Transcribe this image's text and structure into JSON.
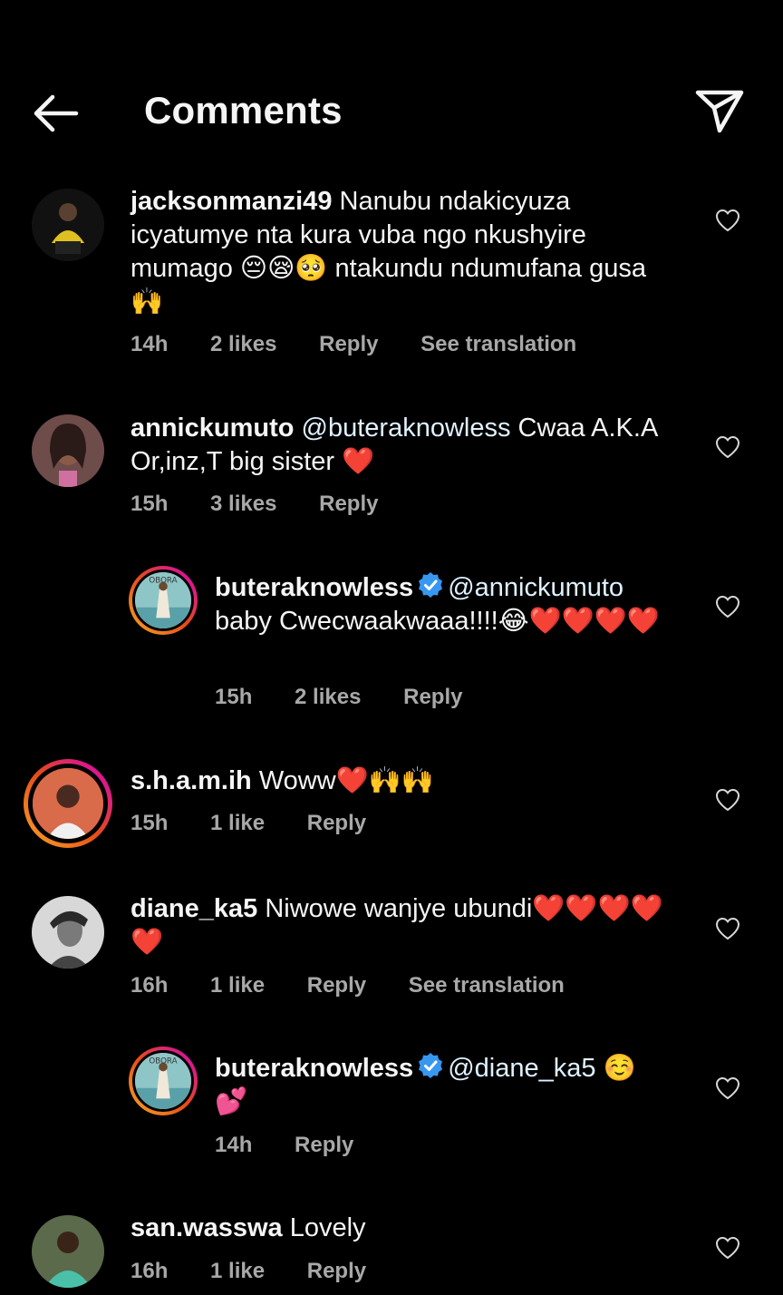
{
  "header": {
    "title": "Comments"
  },
  "comments": [
    {
      "username": "jacksonmanzi49",
      "text": " Nanubu ndakicyuza icyatumye nta kura vuba ngo nkushyire mumago 😔😪🥺 ntakundu ndumufana gusa🙌",
      "time": "14h",
      "likes": "2 likes",
      "reply": "Reply",
      "translation": "See translation"
    },
    {
      "username": "annickumuto",
      "mention": "@buteraknowless",
      "text": "  Cwaa A.K.A Or,inz,T big sister ❤️",
      "time": "15h",
      "likes": "3 likes",
      "reply": "Reply"
    },
    {
      "username": "buteraknowless",
      "mention": "@annickumuto",
      "text": " baby Cwecwaakwaaa!!!!😂❤️❤️❤️❤️",
      "time": "15h",
      "likes": "2 likes",
      "reply": "Reply"
    },
    {
      "username": "s.h.a.m.ih",
      "text": " Woww❤️🙌🙌",
      "time": "15h",
      "likes": "1 like",
      "reply": "Reply"
    },
    {
      "username": "diane_ka5",
      "text": " Niwowe wanjye ubundi❤️❤️❤️❤️❤️",
      "time": "16h",
      "likes": "1 like",
      "reply": "Reply",
      "translation": "See translation"
    },
    {
      "username": "buteraknowless",
      "mention": "@diane_ka5",
      "text": " ☺️💕",
      "time": "14h",
      "reply": "Reply"
    },
    {
      "username": "san.wasswa",
      "text": " Lovely",
      "time": "16h",
      "likes": "1 like",
      "reply": "Reply"
    }
  ],
  "colors": {
    "background": "#000000",
    "text": "#f5f5f5",
    "meta": "#a8a8a8",
    "verified": "#3897f0",
    "story_ring_start": "#f9a825",
    "story_ring_end": "#d300c5"
  },
  "icons": [
    "back-arrow-icon",
    "send-icon",
    "heart-icon",
    "verified-icon"
  ]
}
